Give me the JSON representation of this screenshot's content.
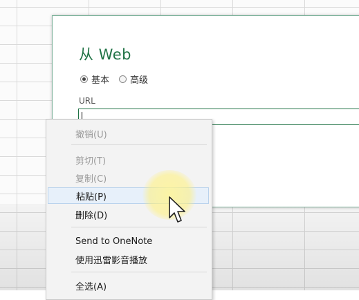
{
  "dialog": {
    "title": "从 Web",
    "mode_basic": "基本",
    "mode_advanced": "高级",
    "selected_mode": "basic",
    "url_label": "URL",
    "url_value": ""
  },
  "context_menu": {
    "items": [
      {
        "label": "撤销(U)",
        "enabled": false
      },
      {
        "label": "剪切(T)",
        "enabled": false
      },
      {
        "label": "复制(C)",
        "enabled": false
      },
      {
        "label": "粘贴(P)",
        "enabled": true,
        "hover": true
      },
      {
        "label": "删除(D)",
        "enabled": true
      },
      {
        "label": "Send to OneNote",
        "enabled": true
      },
      {
        "label": "使用迅雷影音播放",
        "enabled": true
      },
      {
        "label": "全选(A)",
        "enabled": true
      }
    ]
  },
  "colors": {
    "accent": "#217346",
    "menu_hover": "#e7f0fa",
    "disabled_text": "#9a9a9a"
  },
  "icons": {
    "cursor": "arrow-cursor-icon"
  }
}
